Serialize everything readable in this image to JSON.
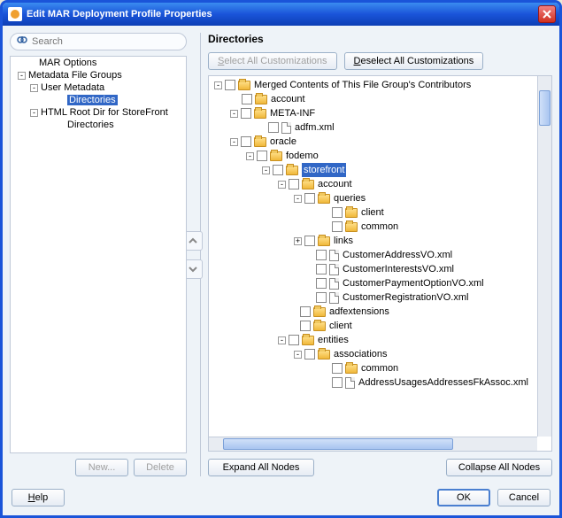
{
  "window": {
    "title": "Edit MAR Deployment Profile Properties"
  },
  "search": {
    "placeholder": "Search"
  },
  "leftTree": {
    "items": [
      {
        "label": "MAR Options",
        "indent": 10,
        "expander": ""
      },
      {
        "label": "Metadata File Groups",
        "indent": 0,
        "expander": "-"
      },
      {
        "label": "User Metadata",
        "indent": 14,
        "expander": "-"
      },
      {
        "label": "Directories",
        "indent": 42,
        "expander": "",
        "selected": true
      },
      {
        "label": "HTML Root Dir for StoreFront",
        "indent": 14,
        "expander": "-"
      },
      {
        "label": "Directories",
        "indent": 42,
        "expander": ""
      }
    ]
  },
  "leftButtons": {
    "new": "New...",
    "delete": "Delete"
  },
  "panel": {
    "title": "Directories"
  },
  "custButtons": {
    "select": "Select All Customizations",
    "deselect": "Deselect All Customizations"
  },
  "rightTree": {
    "rows": [
      {
        "indent": 0,
        "expander": "-",
        "cb": true,
        "icon": "folder",
        "label": "Merged Contents of This File Group's Contributors"
      },
      {
        "indent": 18,
        "expander": "",
        "cb": true,
        "icon": "folder",
        "label": "account"
      },
      {
        "indent": 18,
        "expander": "-",
        "cb": true,
        "icon": "folder",
        "label": "META-INF"
      },
      {
        "indent": 48,
        "expander": "",
        "cb": true,
        "icon": "file",
        "label": "adfm.xml"
      },
      {
        "indent": 18,
        "expander": "-",
        "cb": true,
        "icon": "folder",
        "label": "oracle"
      },
      {
        "indent": 36,
        "expander": "-",
        "cb": true,
        "icon": "folder",
        "label": "fodemo"
      },
      {
        "indent": 54,
        "expander": "-",
        "cb": true,
        "icon": "folder",
        "label": "storefront",
        "selected": true
      },
      {
        "indent": 72,
        "expander": "-",
        "cb": true,
        "icon": "folder",
        "label": "account"
      },
      {
        "indent": 90,
        "expander": "-",
        "cb": true,
        "icon": "folder",
        "label": "queries"
      },
      {
        "indent": 120,
        "expander": "",
        "cb": true,
        "icon": "folder",
        "label": "client"
      },
      {
        "indent": 120,
        "expander": "",
        "cb": true,
        "icon": "folder",
        "label": "common"
      },
      {
        "indent": 90,
        "expander": "+",
        "cb": true,
        "icon": "folder",
        "label": "links"
      },
      {
        "indent": 102,
        "expander": "",
        "cb": true,
        "icon": "file",
        "label": "CustomerAddressVO.xml"
      },
      {
        "indent": 102,
        "expander": "",
        "cb": true,
        "icon": "file",
        "label": "CustomerInterestsVO.xml"
      },
      {
        "indent": 102,
        "expander": "",
        "cb": true,
        "icon": "file",
        "label": "CustomerPaymentOptionVO.xml"
      },
      {
        "indent": 102,
        "expander": "",
        "cb": true,
        "icon": "file",
        "label": "CustomerRegistrationVO.xml"
      },
      {
        "indent": 84,
        "expander": "",
        "cb": true,
        "icon": "folder",
        "label": "adfextensions"
      },
      {
        "indent": 84,
        "expander": "",
        "cb": true,
        "icon": "folder",
        "label": "client"
      },
      {
        "indent": 72,
        "expander": "-",
        "cb": true,
        "icon": "folder",
        "label": "entities"
      },
      {
        "indent": 90,
        "expander": "-",
        "cb": true,
        "icon": "folder",
        "label": "associations"
      },
      {
        "indent": 120,
        "expander": "",
        "cb": true,
        "icon": "folder",
        "label": "common"
      },
      {
        "indent": 120,
        "expander": "",
        "cb": true,
        "icon": "file",
        "label": "AddressUsagesAddressesFkAssoc.xml"
      }
    ]
  },
  "expandButtons": {
    "expand": "Expand All Nodes",
    "collapse": "Collapse All Nodes"
  },
  "bottom": {
    "help": "Help",
    "ok": "OK",
    "cancel": "Cancel"
  }
}
